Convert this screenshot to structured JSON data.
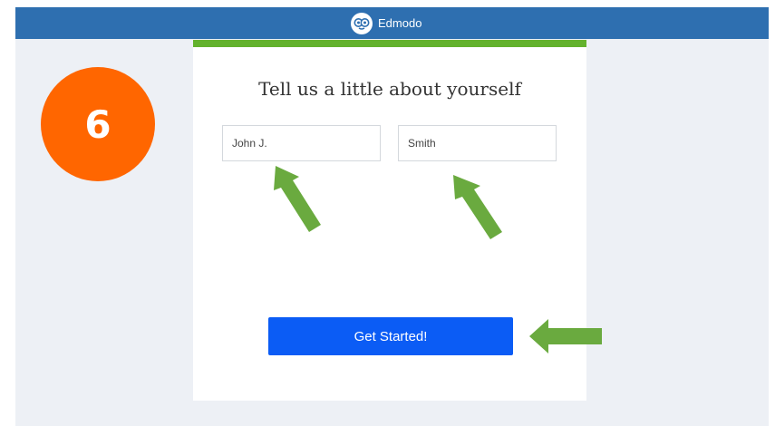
{
  "header": {
    "brand_name": "Edmodo",
    "logo_icon": "edmodo-owl-logo-icon",
    "color": "#2e6fb0"
  },
  "form": {
    "heading": "Tell us a little about yourself",
    "first_name_value": "John J.",
    "last_name_value": "Smith",
    "submit_label": "Get Started!",
    "accent_color": "#63b22d",
    "button_color": "#0b5cf5"
  },
  "annotation": {
    "step_number": "6",
    "step_color": "#ff6600",
    "arrow_color": "#6aaa3f"
  }
}
